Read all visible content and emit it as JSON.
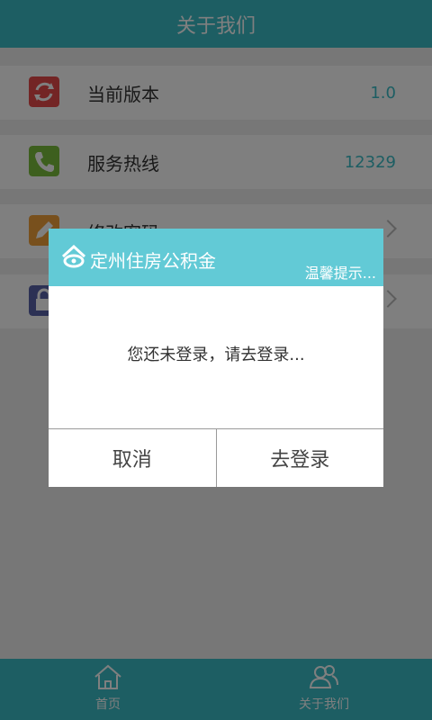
{
  "header": {
    "title": "关于我们"
  },
  "rows": [
    {
      "label": "当前版本",
      "value": "1.0",
      "icon": "refresh-icon",
      "color": "#e64a4a"
    },
    {
      "label": "服务热线",
      "value": "12329",
      "icon": "phone-icon",
      "color": "#7bbf3c"
    },
    {
      "label": "修改密码",
      "value": "",
      "icon": "pencil-icon",
      "color": "#f0a13a"
    },
    {
      "label": "",
      "value": "",
      "icon": "lock-icon",
      "color": "#5863a8"
    }
  ],
  "dialog": {
    "title": "定州住房公积金",
    "hint": "温馨提示...",
    "message": "您还未登录，请去登录...",
    "cancel_label": "取消",
    "confirm_label": "去登录"
  },
  "tabbar": {
    "home_label": "首页",
    "about_label": "关于我们"
  },
  "colors": {
    "accent": "#3bbdc7",
    "dialog_header": "#62cad6"
  }
}
